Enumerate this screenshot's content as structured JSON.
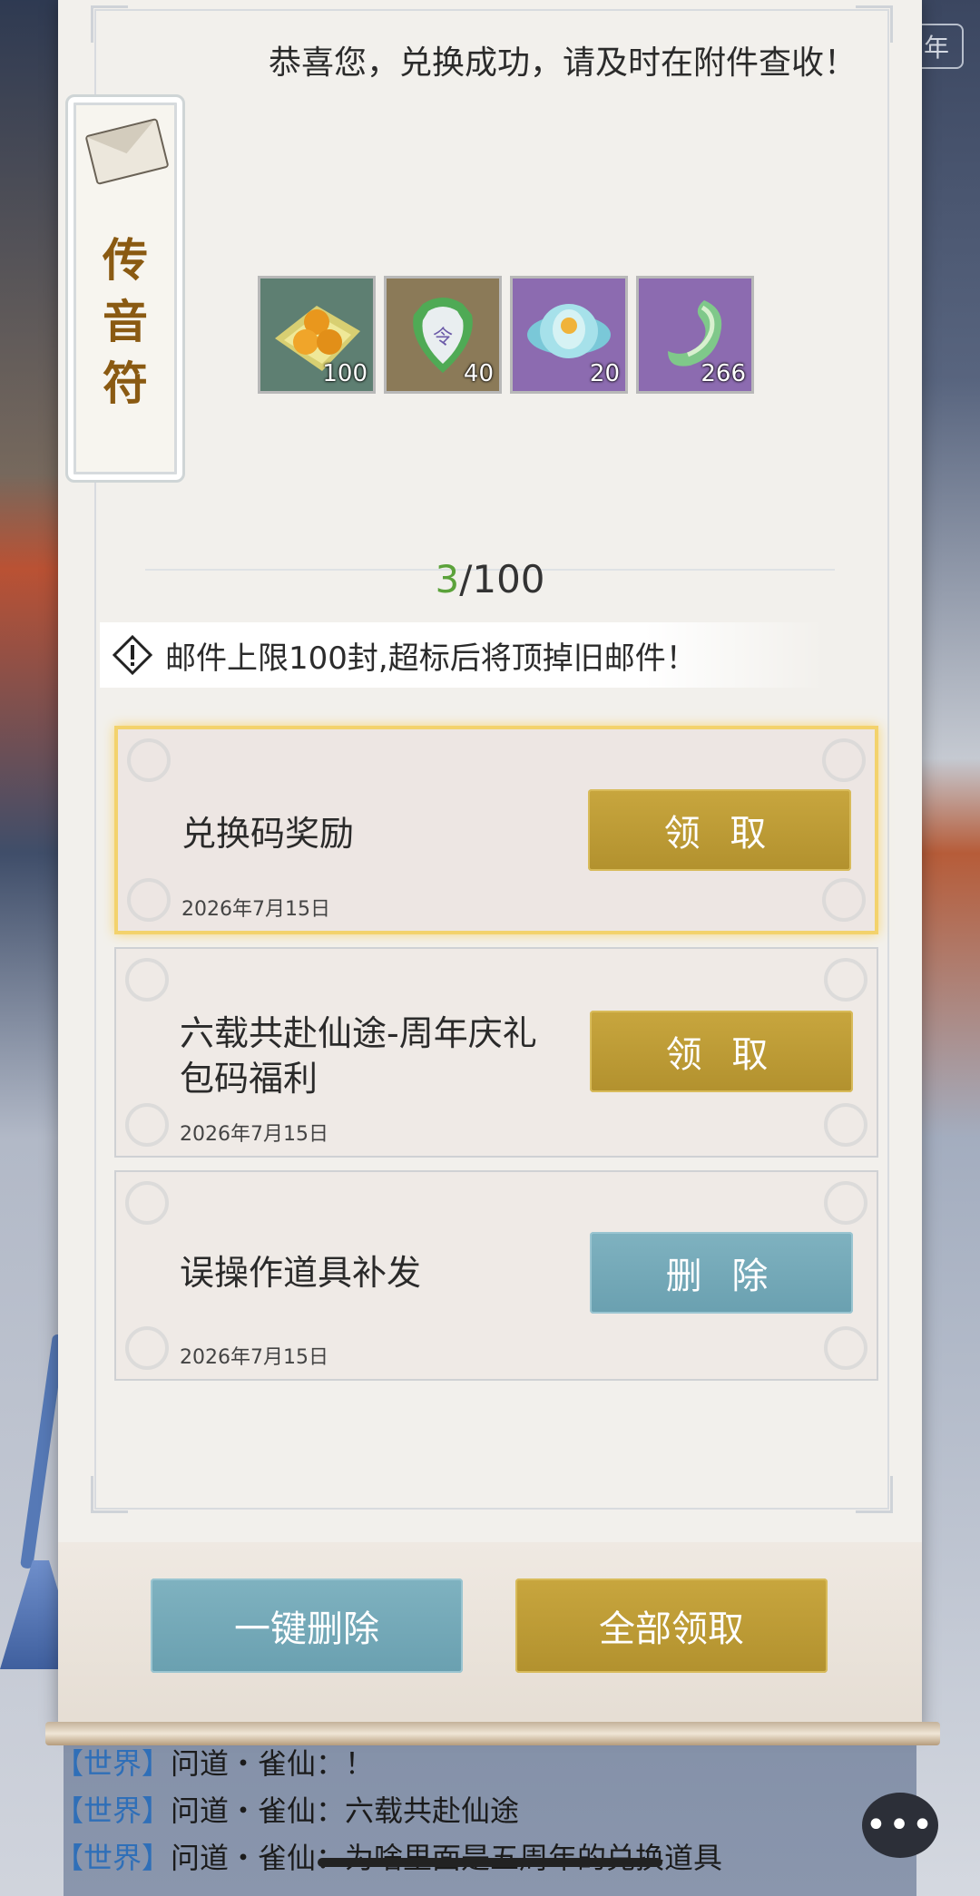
{
  "background": {
    "year_badge": "年"
  },
  "mail_detail": {
    "talisman_label": "传音符",
    "message": "恭喜您，兑换成功，请及时在附件查收！",
    "rewards": [
      {
        "icon": "golden-pills-icon",
        "count": "100",
        "color": "#5e7f72"
      },
      {
        "icon": "jade-token-icon",
        "count": "40",
        "color": "#8b7a58"
      },
      {
        "icon": "lotus-flower-icon",
        "count": "20",
        "color": "#8c6bb0"
      },
      {
        "icon": "jade-dragon-icon",
        "count": "266",
        "color": "#8c6bb0"
      }
    ]
  },
  "mail_counter": {
    "current": "3",
    "total": "/100"
  },
  "notice": "邮件上限100封,超标后将顶掉旧邮件！",
  "mails": [
    {
      "title": "兑换码奖励",
      "date": "2026年7月15日",
      "action": "领 取",
      "selected": true
    },
    {
      "title": "六载共赴仙途-周年庆礼包码福利",
      "date": "2026年7月15日",
      "action": "领 取",
      "selected": false
    },
    {
      "title": "误操作道具补发",
      "date": "2026年7月15日",
      "action": "删 除",
      "selected": false
    }
  ],
  "footer_buttons": {
    "delete_all": "一键删除",
    "claim_all": "全部领取"
  },
  "chat": [
    {
      "channel": "【世界】",
      "text": "问道・雀仙：！"
    },
    {
      "channel": "【世界】",
      "text": "问道・雀仙：六载共赴仙途"
    },
    {
      "channel": "【世界】",
      "text": "问道・雀仙：为啥里面是五周年的兑换道具"
    }
  ],
  "chat_button": "•••",
  "colors": {
    "gold_button": "#b89a34",
    "blue_button": "#74a9b8",
    "counter_accent": "#5ba23a",
    "channel": "#2f6fb8"
  }
}
